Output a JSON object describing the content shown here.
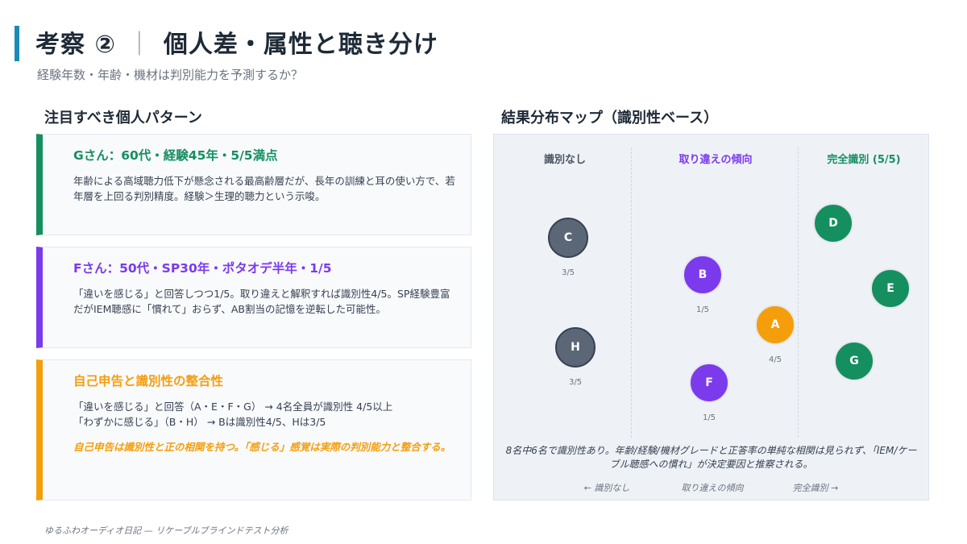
{
  "header": {
    "title_main": "考察 ②",
    "title_sep": "｜",
    "title_sub": "個人差・属性と聴き分け",
    "subtitle": "経験年数・年齢・機材は判別能力を予測するか？"
  },
  "left": {
    "heading": "注目すべき個人パターン",
    "cards": [
      {
        "title": "Gさん：60代・経験45年・5/5満点",
        "body": "年齢による高域聴力低下が懸念される最高齢層だが、長年の訓練と耳の使い方で、若年層を上回る判別精度。経験＞生理的聴力という示唆。",
        "color": "#168f60"
      },
      {
        "title": "Fさん：50代・SP30年・ポタオデ半年・1/5",
        "body": "「違いを感じる」と回答しつつ1/5。取り違えと解釈すれば識別性4/5。SP経験豊富だがIEM聴感に「慣れて」おらず、AB割当の記憶を逆転した可能性。",
        "color": "#7c3aed"
      },
      {
        "title": "自己申告と識別性の整合性",
        "line1": "「違いを感じる」と回答（A・E・F・G） → 4名全員が識別性 4/5以上",
        "line2": "「わずかに感じる」（B・H） → Bは識別性4/5、Hは3/5",
        "note": "自己申告は識別性と正の相関を持つ。「感じる」感覚は実際の判別能力と整合する。",
        "color": "#f59e0b"
      }
    ]
  },
  "right": {
    "heading": "結果分布マップ（識別性ベース）",
    "columns": [
      "識別なし",
      "取り違えの傾向",
      "完全識別 (5/5)"
    ],
    "note": "8名中6名で識別性あり。年齢/経験/機材グレードと正答率の単純な相関は見られず、「IEM/ケーブル聴感への慣れ」が決定要因と推察される。",
    "axis": [
      "← 識別なし",
      "取り違えの傾向",
      "完全識別 →"
    ]
  },
  "chart_data": {
    "type": "scatter",
    "title": "結果分布マップ（識別性ベース）",
    "categories": [
      "識別なし",
      "取り違えの傾向",
      "完全識別 (5/5)"
    ],
    "points": [
      {
        "id": "C",
        "category": "識別なし",
        "score": "3/5",
        "color": "#5b6677"
      },
      {
        "id": "H",
        "category": "識別なし",
        "score": "3/5",
        "color": "#5b6677"
      },
      {
        "id": "B",
        "category": "取り違えの傾向",
        "score": "1/5",
        "color": "#7c3aed"
      },
      {
        "id": "F",
        "category": "取り違えの傾向",
        "score": "1/5",
        "color": "#7c3aed"
      },
      {
        "id": "A",
        "category": "取り違えの傾向",
        "score": "4/5",
        "color": "#f59e0b"
      },
      {
        "id": "D",
        "category": "完全識別 (5/5)",
        "color": "#168f60"
      },
      {
        "id": "E",
        "category": "完全識別 (5/5)",
        "color": "#168f60"
      },
      {
        "id": "G",
        "category": "完全識別 (5/5)",
        "color": "#168f60"
      }
    ]
  },
  "footer": "ゆるふわオーディオ日記 — リケーブルブラインドテスト分析"
}
